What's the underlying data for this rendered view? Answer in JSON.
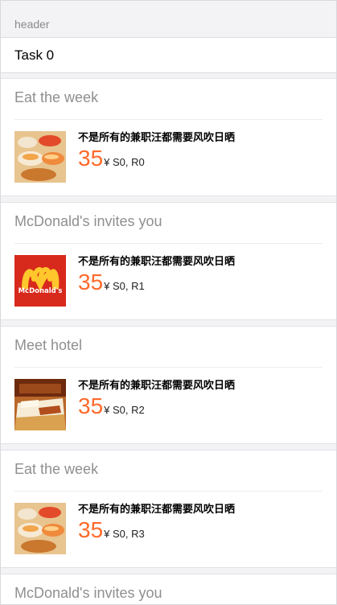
{
  "header": {
    "title": "header"
  },
  "task": {
    "label": "Task 0"
  },
  "cards": [
    {
      "title": "Eat the week",
      "description": "不是所有的兼职汪都需要风吹日晒",
      "price": "35",
      "suffix": "¥ S0, R0",
      "thumb_icon": "sushi-image"
    },
    {
      "title": "McDonald's invites you",
      "description": "不是所有的兼职汪都需要风吹日晒",
      "price": "35",
      "suffix": "¥ S0, R1",
      "thumb_icon": "mcdonalds-logo",
      "logo_text": "McDonald's"
    },
    {
      "title": "Meet hotel",
      "description": "不是所有的兼职汪都需要风吹日晒",
      "price": "35",
      "suffix": "¥ S0, R2",
      "thumb_icon": "hotel-room-image"
    },
    {
      "title": "Eat the week",
      "description": "不是所有的兼职汪都需要风吹日晒",
      "price": "35",
      "suffix": "¥ S0, R3",
      "thumb_icon": "sushi-image"
    },
    {
      "title": "McDonald's invites you"
    }
  ],
  "colors": {
    "price": "#ff6a2b",
    "mcd_red": "#d8291d",
    "mcd_yellow": "#ffc72c"
  }
}
